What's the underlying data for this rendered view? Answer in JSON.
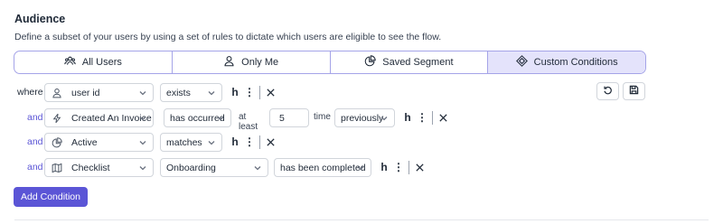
{
  "audience": {
    "title": "Audience",
    "description": "Define a subset of your users by using a set of rules to dictate which users are eligible to see the flow."
  },
  "tabs": [
    {
      "label": "All Users",
      "icon": "users-icon",
      "active": false
    },
    {
      "label": "Only Me",
      "icon": "user-icon",
      "active": false
    },
    {
      "label": "Saved Segment",
      "icon": "pie-chart-icon",
      "active": false
    },
    {
      "label": "Custom Conditions",
      "icon": "diamond-icon",
      "active": true
    }
  ],
  "rows": [
    {
      "prefix": "where",
      "field": "user id",
      "field_icon": "user-icon",
      "operator": "exists"
    },
    {
      "prefix": "and",
      "field": "Created An Invoice",
      "field_icon": "lightning-icon",
      "operator": "has occurred",
      "at_least_label": "at least",
      "count": "5",
      "time_label": "time",
      "timeframe": "previously"
    },
    {
      "prefix": "and",
      "field": "Active",
      "field_icon": "pie-chart-icon",
      "operator": "matches"
    },
    {
      "prefix": "and",
      "field": "Checklist",
      "field_icon": "map-icon",
      "value": "Onboarding",
      "operator": "has been completed"
    }
  ],
  "actions": {
    "undo_icon": "undo-icon",
    "save_icon": "save-icon",
    "add_condition_label": "Add Condition"
  },
  "accent_color": "#5b55d6"
}
